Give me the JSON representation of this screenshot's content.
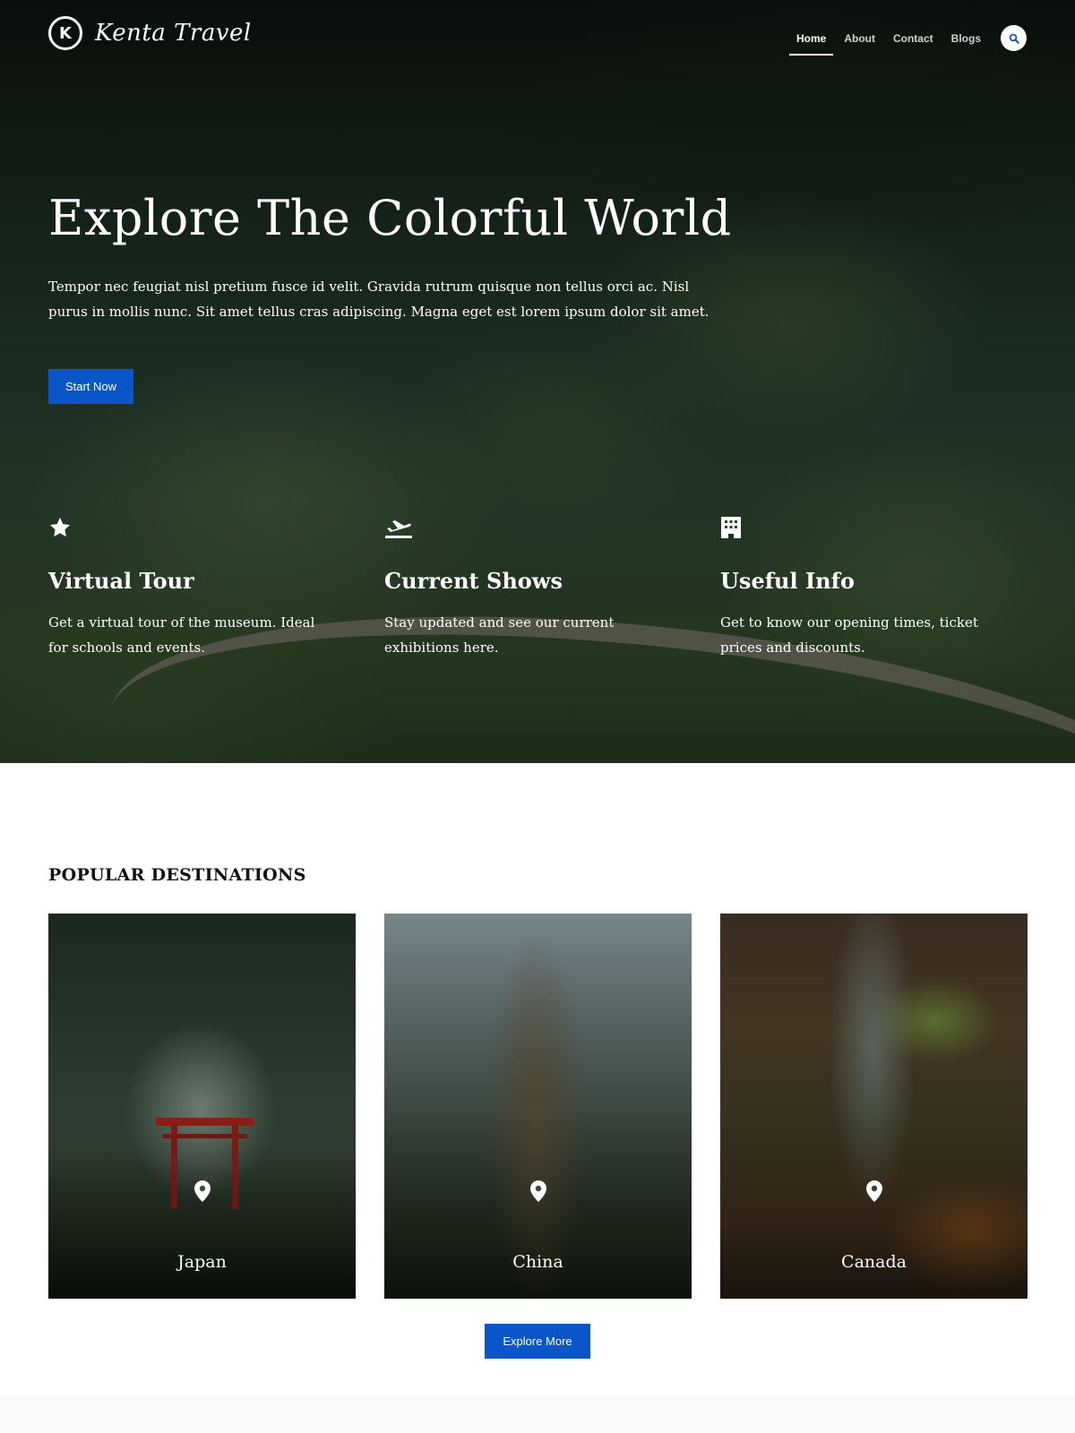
{
  "brand": {
    "logo_letter": "K",
    "name": "Kenta Travel"
  },
  "nav": {
    "items": [
      {
        "label": "Home",
        "active": true
      },
      {
        "label": "About",
        "active": false
      },
      {
        "label": "Contact",
        "active": false
      },
      {
        "label": "Blogs",
        "active": false
      }
    ],
    "search_icon": "search-icon"
  },
  "hero": {
    "title": "Explore The Colorful World",
    "text": "Tempor nec feugiat nisl pretium fusce id velit. Gravida rutrum quisque non tellus orci ac. Nisl purus in mollis nunc. Sit amet tellus cras adipiscing. Magna eget est lorem ipsum dolor sit amet.",
    "cta_label": "Start Now"
  },
  "features": [
    {
      "icon": "star-icon",
      "title": "Virtual Tour",
      "text": "Get a virtual tour of the museum. Ideal for schools and events."
    },
    {
      "icon": "plane-departure-icon",
      "title": "Current Shows",
      "text": "Stay updated and see our current exhibitions here."
    },
    {
      "icon": "building-icon",
      "title": "Useful Info",
      "text": "Get to know our opening times, ticket prices and discounts."
    }
  ],
  "destinations": {
    "heading": "POPULAR DESTINATIONS",
    "cards": [
      {
        "name": "Japan",
        "icon": "map-pin-icon"
      },
      {
        "name": "China",
        "icon": "map-pin-icon"
      },
      {
        "name": "Canada",
        "icon": "map-pin-icon"
      }
    ],
    "cta_label": "Explore More"
  },
  "colors": {
    "accent": "#0a55c7",
    "text_light": "#ffffff",
    "heading_dark": "#111111"
  }
}
